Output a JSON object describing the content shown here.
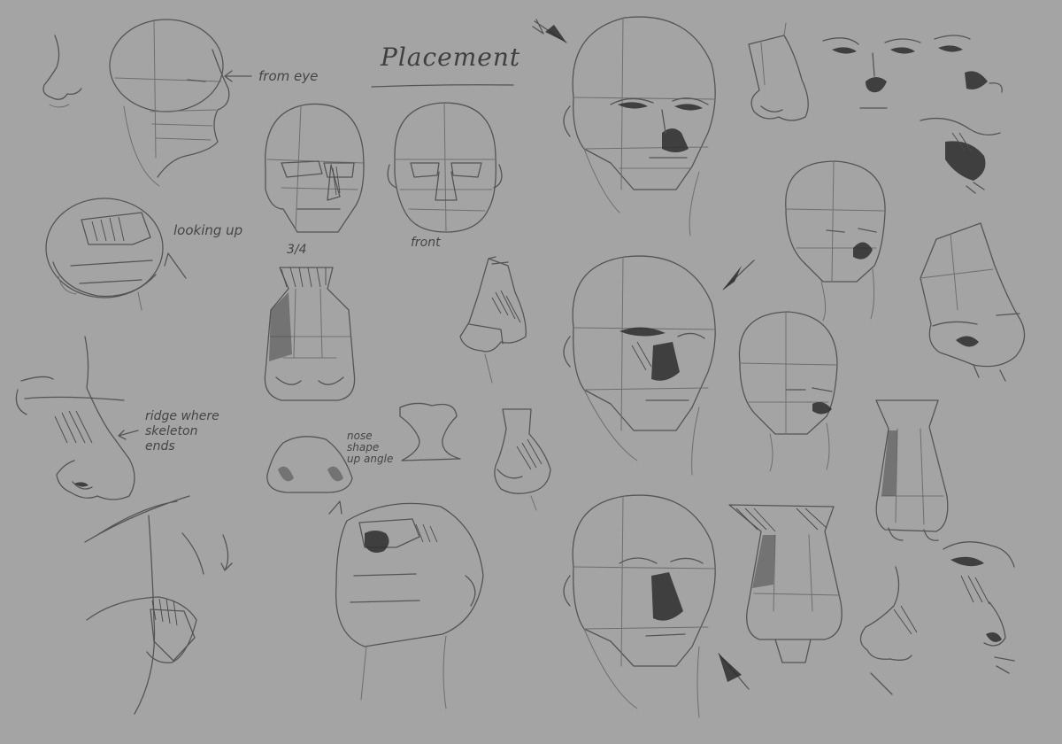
{
  "sheet": {
    "title": "Placement",
    "notes": {
      "from_eye": "from eye",
      "looking_up": "looking up",
      "three_quarter": "3/4",
      "front": "front",
      "ridge": "ridge where\nskeleton\nends",
      "nose_shape": "nose\nshape\nup angle"
    },
    "colors": {
      "paper": "#a4a4a4",
      "line": "#555555",
      "shadow": "#2e2e2e"
    }
  }
}
